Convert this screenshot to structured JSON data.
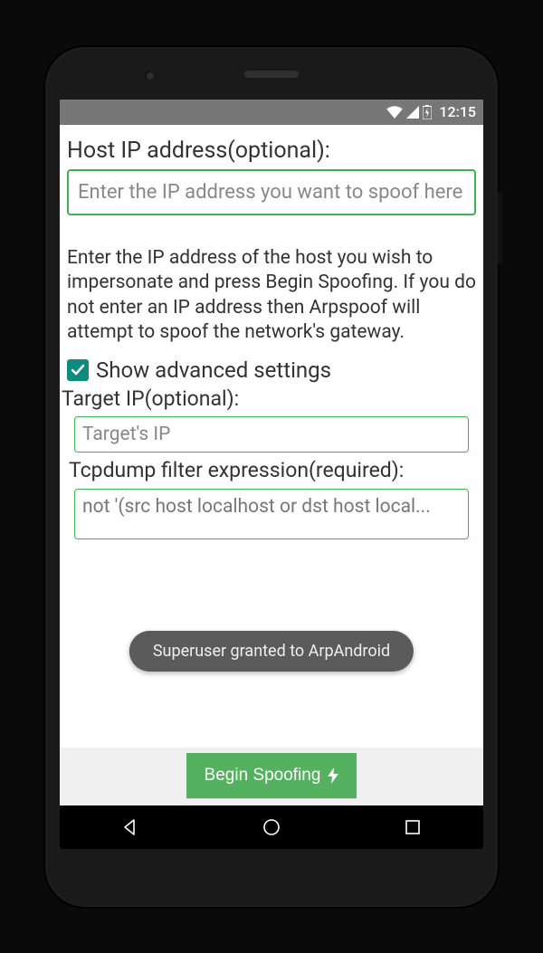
{
  "status": {
    "time": "12:15"
  },
  "hostip": {
    "label": "Host IP address(optional):",
    "placeholder": "Enter the IP address you want to spoof here"
  },
  "description": "Enter the IP address of the host you wish to impersonate and press Begin Spoofing. If you do not enter an IP address then Arpspoof will attempt to spoof the network's gateway.",
  "advanced": {
    "checkbox_label": "Show advanced settings",
    "checked": true
  },
  "targetip": {
    "label": "Target IP(optional):",
    "placeholder": "Target's IP"
  },
  "tcpdump": {
    "label": "Tcpdump filter expression(required):",
    "value": "not '(src host localhost or dst host local..."
  },
  "toast": "Superuser granted to ArpAndroid",
  "button": {
    "label": "Begin Spoofing"
  }
}
